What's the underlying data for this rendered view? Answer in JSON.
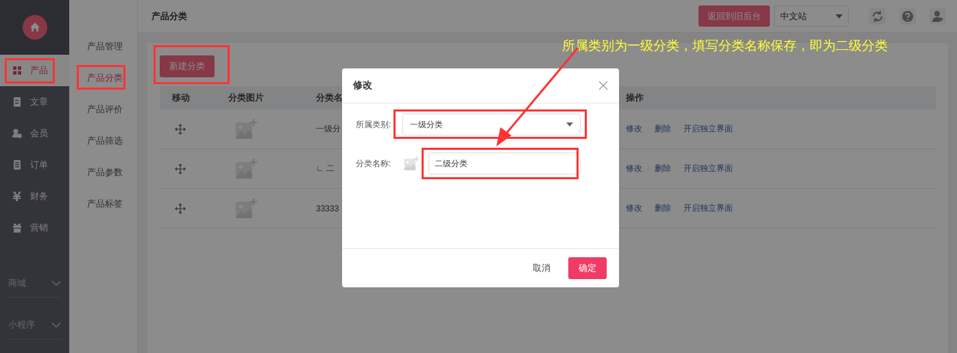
{
  "sidebar": {
    "items": [
      {
        "label": "产品",
        "selected": true
      },
      {
        "label": "文章",
        "selected": false
      },
      {
        "label": "会员",
        "selected": false
      },
      {
        "label": "订单",
        "selected": false
      },
      {
        "label": "财务",
        "selected": false
      },
      {
        "label": "营销",
        "selected": false
      }
    ],
    "groups": [
      {
        "label": "商城",
        "expanded": false
      },
      {
        "label": "小程序",
        "expanded": false
      }
    ]
  },
  "submenu": {
    "items": [
      {
        "label": "产品管理",
        "selected": false
      },
      {
        "label": "产品分类",
        "selected": true
      },
      {
        "label": "产品评价",
        "selected": false
      },
      {
        "label": "产品筛选",
        "selected": false
      },
      {
        "label": "产品参数",
        "selected": false
      },
      {
        "label": "产品标签",
        "selected": false
      }
    ]
  },
  "header": {
    "title": "产品分类",
    "back_button": "返回到旧后台",
    "site_select": "中文站"
  },
  "toolbar": {
    "new_button": "新建分类"
  },
  "table": {
    "columns": [
      "移动",
      "分类图片",
      "分类名",
      "操作"
    ],
    "rows": [
      {
        "name": "一级分",
        "actions": [
          "修改",
          "删除",
          "开启独立界面"
        ]
      },
      {
        "name": "∟ 二",
        "actions": [
          "修改",
          "删除",
          "开启独立界面"
        ]
      },
      {
        "name": "33333",
        "actions": [
          "修改",
          "删除",
          "开启独立界面"
        ]
      }
    ]
  },
  "dialog": {
    "title": "修改",
    "fields": [
      {
        "kind": "select",
        "label": "所属类别:",
        "value": "一级分类"
      },
      {
        "kind": "text",
        "label": "分类名称:",
        "value": "二级分类"
      }
    ],
    "buttons": [
      {
        "kind": "plain",
        "label": "取消"
      },
      {
        "kind": "primary",
        "label": "确定"
      }
    ]
  },
  "annotation": {
    "text": "所属类别为一级分类，填写分类名称保存，即为二级分类"
  }
}
